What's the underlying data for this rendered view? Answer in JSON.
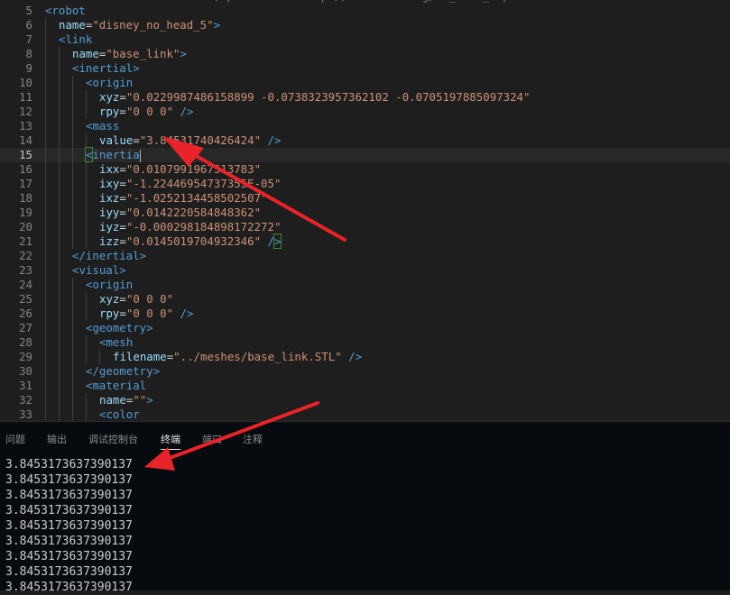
{
  "editor": {
    "top_partial": "<!-- For more information, please see http://wiki.ros.org/sw_urdf_exporter -->",
    "current_line": 15,
    "lines": [
      {
        "n": "5",
        "indent": 0,
        "parts": [
          [
            "tag",
            "<robot"
          ]
        ]
      },
      {
        "n": "6",
        "indent": 1,
        "parts": [
          [
            "attr",
            "name"
          ],
          [
            "eq",
            "="
          ],
          [
            "str",
            "\"disney_no_head_5\""
          ],
          [
            "tag",
            ">"
          ]
        ]
      },
      {
        "n": "7",
        "indent": 1,
        "parts": [
          [
            "tag",
            "<link"
          ]
        ]
      },
      {
        "n": "8",
        "indent": 2,
        "parts": [
          [
            "attr",
            "name"
          ],
          [
            "eq",
            "="
          ],
          [
            "str",
            "\"base_link\""
          ],
          [
            "tag",
            ">"
          ]
        ]
      },
      {
        "n": "9",
        "indent": 2,
        "parts": [
          [
            "tag",
            "<inertial>"
          ]
        ]
      },
      {
        "n": "10",
        "indent": 3,
        "parts": [
          [
            "tag",
            "<origin"
          ]
        ]
      },
      {
        "n": "11",
        "indent": 4,
        "parts": [
          [
            "attr",
            "xyz"
          ],
          [
            "eq",
            "="
          ],
          [
            "str",
            "\"0.0229987486158899 -0.0738323957362102 -0.0705197885097324\""
          ]
        ]
      },
      {
        "n": "12",
        "indent": 4,
        "parts": [
          [
            "attr",
            "rpy"
          ],
          [
            "eq",
            "="
          ],
          [
            "str",
            "\"0 0 0\""
          ],
          [
            "tag",
            " />"
          ]
        ]
      },
      {
        "n": "13",
        "indent": 3,
        "parts": [
          [
            "tag",
            "<mass"
          ]
        ]
      },
      {
        "n": "14",
        "indent": 4,
        "parts": [
          [
            "attr",
            "value"
          ],
          [
            "eq",
            "="
          ],
          [
            "str",
            "\"3.84531740426424\""
          ],
          [
            "tag",
            " />"
          ]
        ]
      },
      {
        "n": "15",
        "indent": 3,
        "parts": [
          [
            "hltag",
            "<"
          ],
          [
            "tag",
            "inertia"
          ],
          [
            "caret",
            ""
          ]
        ]
      },
      {
        "n": "16",
        "indent": 4,
        "parts": [
          [
            "attr",
            "ixx"
          ],
          [
            "eq",
            "="
          ],
          [
            "str",
            "\"0.0107991967513783\""
          ]
        ]
      },
      {
        "n": "17",
        "indent": 4,
        "parts": [
          [
            "attr",
            "ixy"
          ],
          [
            "eq",
            "="
          ],
          [
            "str",
            "\"-1.22446954737355E-05\""
          ]
        ]
      },
      {
        "n": "18",
        "indent": 4,
        "parts": [
          [
            "attr",
            "ixz"
          ],
          [
            "eq",
            "="
          ],
          [
            "str",
            "\"-1.0252134458502507\""
          ]
        ]
      },
      {
        "n": "19",
        "indent": 4,
        "parts": [
          [
            "attr",
            "iyy"
          ],
          [
            "eq",
            "="
          ],
          [
            "str",
            "\"0.0142220584848362\""
          ]
        ]
      },
      {
        "n": "20",
        "indent": 4,
        "parts": [
          [
            "attr",
            "iyz"
          ],
          [
            "eq",
            "="
          ],
          [
            "str",
            "\"-0.000298184898172272\""
          ]
        ]
      },
      {
        "n": "21",
        "indent": 4,
        "parts": [
          [
            "attr",
            "izz"
          ],
          [
            "eq",
            "="
          ],
          [
            "str",
            "\"0.0145019704932346\""
          ],
          [
            "tag",
            " /"
          ],
          [
            "hltag",
            ">"
          ]
        ]
      },
      {
        "n": "22",
        "indent": 2,
        "parts": [
          [
            "tag",
            "</inertial>"
          ]
        ]
      },
      {
        "n": "23",
        "indent": 2,
        "parts": [
          [
            "tag",
            "<visual>"
          ]
        ]
      },
      {
        "n": "24",
        "indent": 3,
        "parts": [
          [
            "tag",
            "<origin"
          ]
        ]
      },
      {
        "n": "25",
        "indent": 4,
        "parts": [
          [
            "attr",
            "xyz"
          ],
          [
            "eq",
            "="
          ],
          [
            "str",
            "\"0 0 0\""
          ]
        ]
      },
      {
        "n": "26",
        "indent": 4,
        "parts": [
          [
            "attr",
            "rpy"
          ],
          [
            "eq",
            "="
          ],
          [
            "str",
            "\"0 0 0\""
          ],
          [
            "tag",
            " />"
          ]
        ]
      },
      {
        "n": "27",
        "indent": 3,
        "parts": [
          [
            "tag",
            "<geometry>"
          ]
        ]
      },
      {
        "n": "28",
        "indent": 4,
        "parts": [
          [
            "tag",
            "<mesh"
          ]
        ]
      },
      {
        "n": "29",
        "indent": 5,
        "parts": [
          [
            "attr",
            "filename"
          ],
          [
            "eq",
            "="
          ],
          [
            "str",
            "\"../meshes/base_link.STL\""
          ],
          [
            "tag",
            " />"
          ]
        ]
      },
      {
        "n": "30",
        "indent": 3,
        "parts": [
          [
            "tag",
            "</geometry>"
          ]
        ]
      },
      {
        "n": "31",
        "indent": 3,
        "parts": [
          [
            "tag",
            "<material"
          ]
        ]
      },
      {
        "n": "32",
        "indent": 4,
        "parts": [
          [
            "attr",
            "name"
          ],
          [
            "eq",
            "="
          ],
          [
            "str",
            "\"\""
          ],
          [
            "tag",
            ">"
          ]
        ]
      },
      {
        "n": "33",
        "indent": 4,
        "parts": [
          [
            "tag",
            "<color"
          ]
        ]
      }
    ]
  },
  "panel": {
    "tabs": [
      {
        "label": "问题",
        "active": false
      },
      {
        "label": "输出",
        "active": false
      },
      {
        "label": "调试控制台",
        "active": false
      },
      {
        "label": "终端",
        "active": true
      },
      {
        "label": "端口",
        "active": false
      },
      {
        "label": "注释",
        "active": false
      }
    ],
    "terminal_lines": [
      "3.8453173637390137",
      "3.8453173637390137",
      "3.8453173637390137",
      "3.8453173637390137",
      "3.8453173637390137",
      "3.8453173637390137",
      "3.8453173637390137",
      "3.8453173637390137",
      "3.8453173637390137"
    ]
  },
  "colors": {
    "arrow": "#e8232a",
    "tag": "#569cd6",
    "attr": "#9cdcfe",
    "string": "#ce9178"
  }
}
